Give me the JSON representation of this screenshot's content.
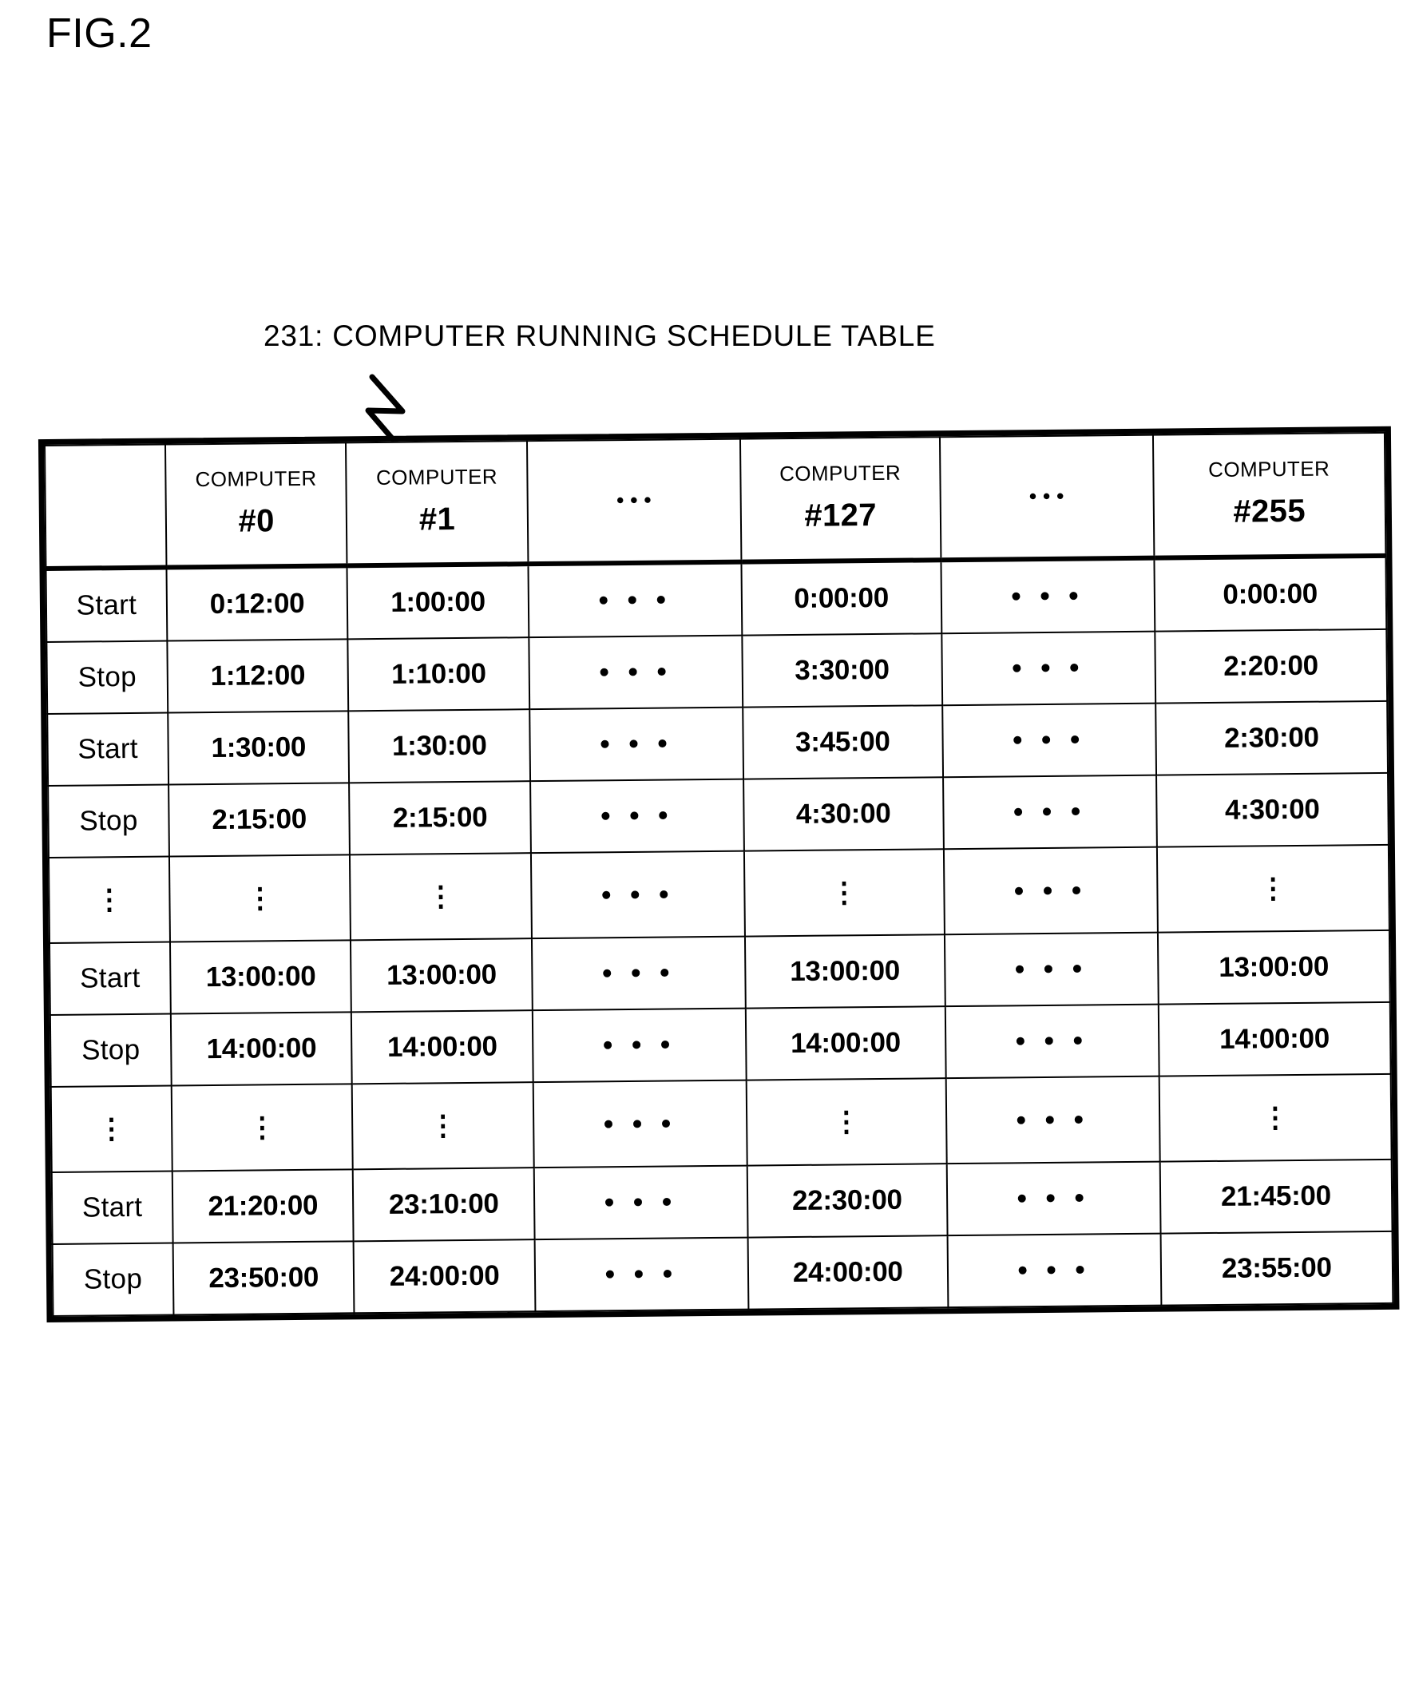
{
  "figure": {
    "label": "FIG.2",
    "caption": "231: COMPUTER RUNNING SCHEDULE TABLE"
  },
  "table": {
    "corner_label": "",
    "columns": [
      {
        "kind": "label",
        "name": "",
        "number": ""
      },
      {
        "kind": "column",
        "name": "COMPUTER",
        "number": "#0"
      },
      {
        "kind": "column",
        "name": "COMPUTER",
        "number": "#1"
      },
      {
        "kind": "ellipsis",
        "name": "• • •",
        "number": ""
      },
      {
        "kind": "column",
        "name": "COMPUTER",
        "number": "#127"
      },
      {
        "kind": "ellipsis",
        "name": "• • •",
        "number": ""
      },
      {
        "kind": "column",
        "name": "COMPUTER",
        "number": "#255"
      }
    ],
    "rows": [
      {
        "kind": "data",
        "label": "Start",
        "values": [
          "0:12:00",
          "1:00:00",
          "• • •",
          "0:00:00",
          "• • •",
          "0:00:00"
        ]
      },
      {
        "kind": "data",
        "label": "Stop",
        "values": [
          "1:12:00",
          "1:10:00",
          "• • •",
          "3:30:00",
          "• • •",
          "2:20:00"
        ]
      },
      {
        "kind": "data",
        "label": "Start",
        "values": [
          "1:30:00",
          "1:30:00",
          "• • •",
          "3:45:00",
          "• • •",
          "2:30:00"
        ]
      },
      {
        "kind": "data",
        "label": "Stop",
        "values": [
          "2:15:00",
          "2:15:00",
          "• • •",
          "4:30:00",
          "• • •",
          "4:30:00"
        ]
      },
      {
        "kind": "vellipsis",
        "label": "⋮",
        "values": [
          "⋮",
          "⋮",
          "• • •",
          "⋮",
          "• • •",
          "⋮"
        ]
      },
      {
        "kind": "data",
        "label": "Start",
        "values": [
          "13:00:00",
          "13:00:00",
          "• • •",
          "13:00:00",
          "• • •",
          "13:00:00"
        ]
      },
      {
        "kind": "data",
        "label": "Stop",
        "values": [
          "14:00:00",
          "14:00:00",
          "• • •",
          "14:00:00",
          "• • •",
          "14:00:00"
        ]
      },
      {
        "kind": "vellipsis",
        "label": "⋮",
        "values": [
          "⋮",
          "⋮",
          "• • •",
          "⋮",
          "• • •",
          "⋮"
        ]
      },
      {
        "kind": "data",
        "label": "Start",
        "values": [
          "21:20:00",
          "23:10:00",
          "• • •",
          "22:30:00",
          "• • •",
          "21:45:00"
        ]
      },
      {
        "kind": "data",
        "label": "Stop",
        "values": [
          "23:50:00",
          "24:00:00",
          "• • •",
          "24:00:00",
          "• • •",
          "23:55:00"
        ]
      }
    ]
  },
  "colors": {
    "ink": "#000000",
    "paper": "#ffffff"
  }
}
